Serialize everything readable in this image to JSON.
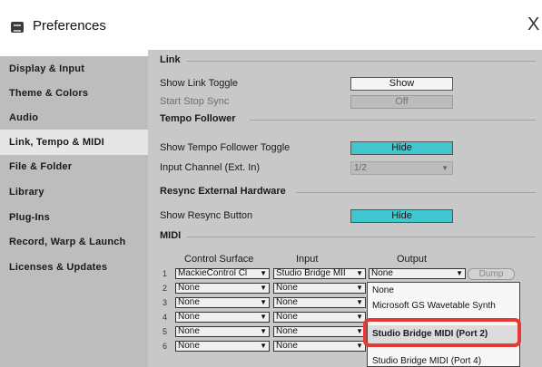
{
  "window": {
    "title": "Preferences",
    "close_glyph": "X"
  },
  "sidebar": {
    "items": [
      {
        "label": "Display & Input",
        "active": false
      },
      {
        "label": "Theme & Colors",
        "active": false
      },
      {
        "label": "Audio",
        "active": false
      },
      {
        "label": "Link, Tempo & MIDI",
        "active": true
      },
      {
        "label": "File & Folder",
        "active": false
      },
      {
        "label": "Library",
        "active": false
      },
      {
        "label": "Plug-Ins",
        "active": false
      },
      {
        "label": "Record, Warp & Launch",
        "active": false
      },
      {
        "label": "Licenses & Updates",
        "active": false
      }
    ]
  },
  "link": {
    "section_title": "Link",
    "show_link_toggle_label": "Show Link Toggle",
    "show_link_toggle_value": "Show",
    "start_stop_sync_label": "Start Stop Sync",
    "start_stop_sync_value": "Off"
  },
  "tempo_follower": {
    "section_title": "Tempo Follower",
    "toggle_label": "Show Tempo Follower Toggle",
    "toggle_value": "Hide",
    "input_channel_label": "Input Channel (Ext. In)",
    "input_channel_value": "1/2"
  },
  "resync": {
    "section_title": "Resync External Hardware",
    "button_label": "Show Resync Button",
    "button_value": "Hide"
  },
  "midi": {
    "section_title": "MIDI",
    "columns": {
      "control_surface": "Control Surface",
      "input": "Input",
      "output": "Output"
    },
    "dump_label": "Dump",
    "rows": [
      {
        "num": "1",
        "surface": "MackieControl Cl",
        "input": "Studio Bridge MII",
        "output": "None"
      },
      {
        "num": "2",
        "surface": "None",
        "input": "None"
      },
      {
        "num": "3",
        "surface": "None",
        "input": "None"
      },
      {
        "num": "4",
        "surface": "None",
        "input": "None"
      },
      {
        "num": "5",
        "surface": "None",
        "input": "None"
      },
      {
        "num": "6",
        "surface": "None",
        "input": "None"
      }
    ]
  },
  "output_dropdown": {
    "options": [
      "None",
      "Microsoft GS Wavetable Synth",
      "Studio Bridge MIDI (Port 2)",
      "Studio Bridge MIDI (Port 4)"
    ],
    "highlighted_index": 2
  },
  "colors": {
    "sidebar_bg": "#bdbdbd",
    "content_bg": "#c8c8c8",
    "hide_button": "#3fc6cf",
    "highlight_ring": "#e53935"
  }
}
